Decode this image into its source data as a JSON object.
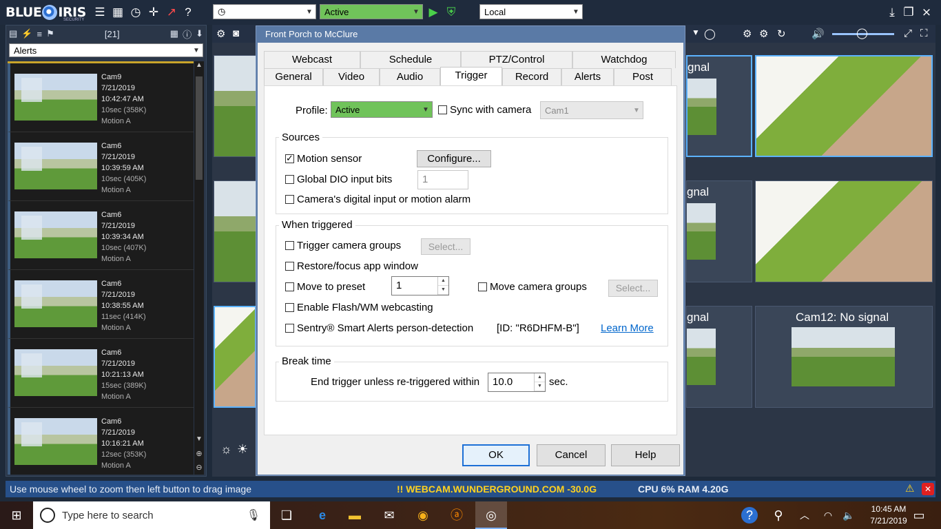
{
  "app": {
    "logo_text_left": "BLUE",
    "logo_text_right": "IRIS",
    "logo_subtext": "SECURITY"
  },
  "topbar": {
    "profile_combo": "",
    "active_combo": "Active",
    "server_combo": "Local"
  },
  "left_panel": {
    "count": "[21]",
    "filter": "Alerts",
    "alerts": [
      {
        "camera": "Cam9",
        "date": "7/21/2019",
        "time": "10:42:47 AM",
        "info": "10sec (358K)",
        "type": "Motion A"
      },
      {
        "camera": "Cam6",
        "date": "7/21/2019",
        "time": "10:39:59 AM",
        "info": "10sec (405K)",
        "type": "Motion A"
      },
      {
        "camera": "Cam6",
        "date": "7/21/2019",
        "time": "10:39:34 AM",
        "info": "10sec (407K)",
        "type": "Motion A"
      },
      {
        "camera": "Cam6",
        "date": "7/21/2019",
        "time": "10:38:55 AM",
        "info": "11sec (414K)",
        "type": "Motion A"
      },
      {
        "camera": "Cam6",
        "date": "7/21/2019",
        "time": "10:21:13 AM",
        "info": "15sec (389K)",
        "type": "Motion A"
      },
      {
        "camera": "Cam6",
        "date": "7/21/2019",
        "time": "10:16:21 AM",
        "info": "12sec (353K)",
        "type": "Motion A"
      }
    ]
  },
  "cameras": {
    "tile1_label": "gnal",
    "tile2_label": "gnal",
    "tile3_label": "gnal",
    "tile4_label": "Cam12: No signal"
  },
  "dialog": {
    "title": "Front Porch to McClure",
    "tabs_row1": [
      "Webcast",
      "Schedule",
      "PTZ/Control",
      "Watchdog"
    ],
    "tabs_row2": [
      "General",
      "Video",
      "Audio",
      "Trigger",
      "Record",
      "Alerts",
      "Post"
    ],
    "active_tab": "Trigger",
    "profile_label": "Profile:",
    "profile_value": "Active",
    "sync_label": "Sync with camera",
    "sync_camera": "Cam1",
    "sources": {
      "title": "Sources",
      "motion_sensor": "Motion sensor",
      "configure_btn": "Configure...",
      "global_dio": "Global DIO input bits",
      "dio_value": "1",
      "digital_input": "Camera's digital input or motion alarm"
    },
    "when_triggered": {
      "title": "When triggered",
      "trigger_groups": "Trigger camera groups",
      "select_btn_1": "Select...",
      "restore_focus": "Restore/focus app window",
      "move_preset": "Move to preset",
      "preset_value": "1",
      "move_groups": "Move camera groups",
      "select_btn_2": "Select...",
      "flash_webcast": "Enable Flash/WM webcasting",
      "sentry": "Sentry® Smart Alerts person-detection",
      "sentry_id": "[ID: \"R6DHFM-B\"]",
      "learn_more": "Learn More"
    },
    "break_time": {
      "title": "Break time",
      "label": "End trigger unless re-triggered within",
      "value": "10.0",
      "unit": "sec."
    },
    "ok": "OK",
    "cancel": "Cancel",
    "help": "Help"
  },
  "statusbar": {
    "hint": "Use mouse wheel to zoom then left button to drag image",
    "webcam": "!! WEBCAM.WUNDERGROUND.COM -30.0G",
    "cpu": "CPU 6% RAM 4.20G"
  },
  "taskbar": {
    "search_placeholder": "Type here to search",
    "clock_time": "10:45 AM",
    "clock_date": "7/21/2019"
  },
  "colors": {
    "accent_green": "#70c35a",
    "status_blue": "#27508a",
    "selection_blue": "#5cb3ff"
  }
}
